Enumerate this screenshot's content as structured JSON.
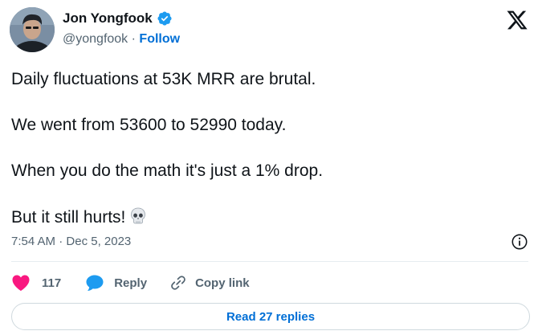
{
  "author": {
    "name": "Jon Yongfook",
    "handle": "@yongfook",
    "separator": "·",
    "follow_label": "Follow",
    "verified": true
  },
  "tweet": {
    "lines": [
      "Daily fluctuations at 53K MRR are brutal.",
      "We went from 53600 to 52990 today.",
      "When you do the math it's just a 1% drop.",
      "But it still hurts!"
    ],
    "emoji": "skull-emoji"
  },
  "meta": {
    "time": "7:54 AM",
    "separator": "·",
    "date": "Dec 5, 2023"
  },
  "actions": {
    "like_count": "117",
    "reply_label": "Reply",
    "copy_label": "Copy link"
  },
  "read_replies_label": "Read 27 replies",
  "colors": {
    "text": "#0f1419",
    "secondary": "#536471",
    "link": "#006fd6",
    "like": "#f91880",
    "reply": "#1d9bf0",
    "verified": "#1d9bf0",
    "border": "#cfd9de"
  },
  "icons": {
    "logo": "x-logo-icon",
    "verified": "verified-badge-icon",
    "info": "info-icon",
    "like": "heart-icon",
    "reply": "speech-bubble-icon",
    "copy": "link-icon"
  }
}
